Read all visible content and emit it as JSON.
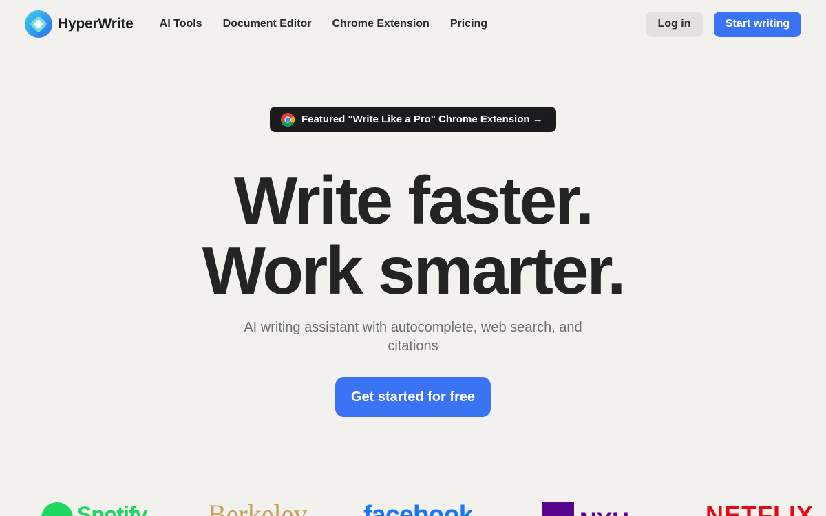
{
  "header": {
    "brand": "HyperWrite",
    "nav": [
      {
        "label": "AI Tools"
      },
      {
        "label": "Document Editor"
      },
      {
        "label": "Chrome Extension"
      },
      {
        "label": "Pricing"
      }
    ],
    "login_label": "Log in",
    "start_label": "Start writing"
  },
  "featured": {
    "label": "Featured \"Write Like a Pro\" Chrome Extension →",
    "icon": "chrome-icon"
  },
  "hero": {
    "title_line1": "Write faster.",
    "title_line2": "Work smarter.",
    "subtitle": "AI writing assistant with autocomplete, web search, and citations",
    "cta_label": "Get started for free"
  },
  "logos": {
    "spotify": "Spotify",
    "berkeley": "Berkeley",
    "facebook": "facebook",
    "nyu": "NYU",
    "netflix": "NETFLIX"
  },
  "colors": {
    "background": "#f2f1ee",
    "accent": "#3b73f5",
    "pill": "#1c1c1e"
  }
}
